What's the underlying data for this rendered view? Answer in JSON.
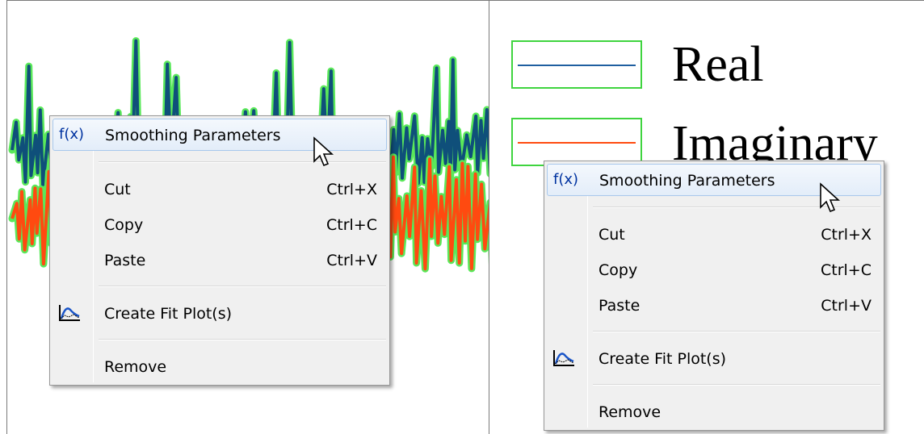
{
  "legend": {
    "items": [
      {
        "label": "Real",
        "color": "#1f5fa0"
      },
      {
        "label": "Imaginary",
        "color": "#ff4a10"
      }
    ],
    "outline_color": "#3fd43f"
  },
  "context_menu": {
    "items": [
      {
        "label": "Smoothing Parameters",
        "shortcut": "",
        "icon": "fx-icon",
        "icon_text": "f(x)",
        "highlighted": true
      },
      {
        "label": "Cut",
        "shortcut": "Ctrl+X"
      },
      {
        "label": "Copy",
        "shortcut": "Ctrl+C"
      },
      {
        "label": "Paste",
        "shortcut": "Ctrl+V"
      },
      {
        "label": "Create Fit Plot(s)",
        "shortcut": "",
        "icon": "fit-plot-icon"
      },
      {
        "label": "Remove",
        "shortcut": ""
      }
    ]
  },
  "plot": {
    "series_colors": {
      "real": "#0f4f7a",
      "imaginary": "#ff4a10",
      "highlight": "#5ae85a"
    }
  }
}
